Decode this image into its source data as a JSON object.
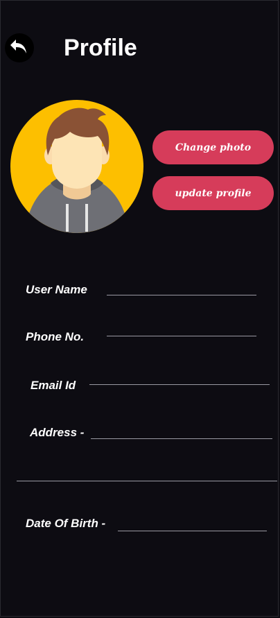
{
  "header": {
    "back_icon": "back-arrow-icon",
    "title": "Profile"
  },
  "avatar": {
    "icon": "user-avatar-icon",
    "background": "#fdbf00"
  },
  "actions": {
    "change_photo": "Change photo",
    "update_profile": "update profile",
    "button_color": "#d63c5a"
  },
  "form": {
    "user_name_label": "User Name",
    "phone_label": "Phone No.",
    "email_label": "Email Id",
    "address_label": "Address -",
    "dob_label": "Date Of Birth -"
  },
  "colors": {
    "background": "#0d0c12",
    "text": "#ffffff",
    "field_line": "#9a9aa3"
  }
}
